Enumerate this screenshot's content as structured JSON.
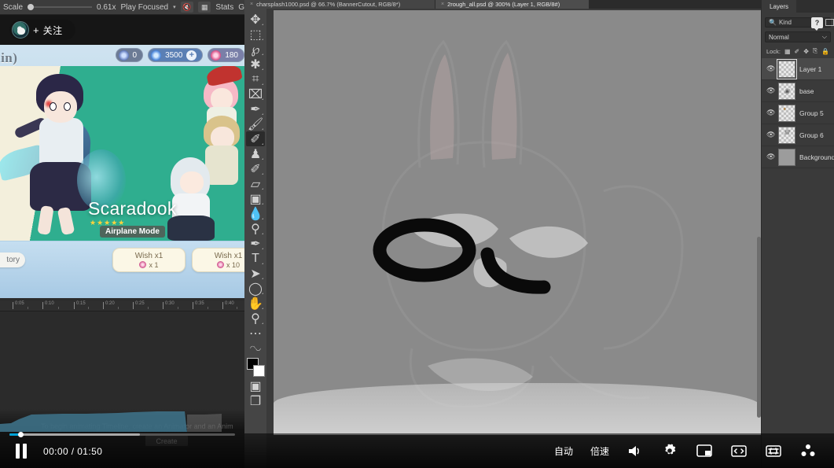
{
  "unity_toolbar": {
    "scale_label": "Scale",
    "scale_value": "0.61x",
    "play_mode": "Play Focused",
    "caret": "▾",
    "audio_icon": "speaker-mute-icon",
    "gizmo_icon": "gizmos-icon",
    "stats_label": "Stats",
    "gizmos_label": "G"
  },
  "game": {
    "follow": {
      "plus": "+",
      "label": "关注"
    },
    "banner_title": "enshin)",
    "currency": [
      {
        "id": "primogem-alt",
        "value": "0",
        "has_plus": false
      },
      {
        "id": "primogem",
        "value": "3500",
        "has_plus": true
      },
      {
        "id": "fate",
        "value": "180",
        "has_plus": false
      }
    ],
    "character_name": "Scaradook",
    "stars": "★★★★★",
    "subtitle": "Airplane Mode",
    "history_button": "tory",
    "wish_buttons": [
      {
        "label": "Wish x1",
        "cost": "x 1"
      },
      {
        "label": "Wish x1",
        "cost": "x 10"
      }
    ]
  },
  "timeline": {
    "ticks": [
      "0:05",
      "0:10",
      "0:15",
      "0:20",
      "0:25",
      "0:30",
      "0:35",
      "0:40"
    ],
    "message": "To begin animating Timeline, create an Animator and an Anim",
    "create_button": "Create"
  },
  "player": {
    "pause_icon": "pause-icon",
    "current_time": "00:00",
    "separator": "/",
    "duration": "01:50",
    "controls": [
      {
        "name": "auto-quality-button",
        "label": "自动",
        "type": "text"
      },
      {
        "name": "playback-speed-button",
        "label": "倍速",
        "type": "text"
      },
      {
        "name": "volume-icon",
        "label": "🔊",
        "type": "icon"
      },
      {
        "name": "settings-gear-icon",
        "label": "⚙",
        "type": "icon"
      },
      {
        "name": "picture-in-picture-icon",
        "label": "◱",
        "type": "icon"
      },
      {
        "name": "wide-screen-icon",
        "label": "⬌",
        "type": "icon"
      },
      {
        "name": "fullscreen-icon",
        "label": "⛶",
        "type": "icon"
      },
      {
        "name": "danmaku-icon",
        "label": "☢",
        "type": "icon"
      }
    ]
  },
  "photoshop": {
    "tabs": [
      {
        "title": "charsplash1000.psd @ 66.7% (BannerCutout, RGB/8*)",
        "close": "×",
        "active": false
      },
      {
        "title": "2rough_all.psd @ 300% (Layer 1, RGB/8#)",
        "close": "×",
        "active": true
      }
    ],
    "tools": [
      {
        "name": "move-tool",
        "glyph": "✥"
      },
      {
        "name": "rectangular-marquee-tool",
        "glyph": "⬚"
      },
      {
        "name": "lasso-tool",
        "glyph": "℘"
      },
      {
        "name": "magic-wand-tool",
        "glyph": "✱"
      },
      {
        "name": "crop-tool",
        "glyph": "⌗"
      },
      {
        "name": "frame-tool",
        "glyph": "⌧"
      },
      {
        "name": "eyedropper-tool",
        "glyph": "✒"
      },
      {
        "name": "spot-healing-brush-tool",
        "glyph": "✚"
      },
      {
        "name": "brush-tool",
        "glyph": "✐",
        "selected": true
      },
      {
        "name": "clone-stamp-tool",
        "glyph": "♟"
      },
      {
        "name": "history-brush-tool",
        "glyph": "✄"
      },
      {
        "name": "eraser-tool",
        "glyph": "◱"
      },
      {
        "name": "gradient-tool",
        "glyph": "▣"
      },
      {
        "name": "blur-tool",
        "glyph": "●"
      },
      {
        "name": "dodge-tool",
        "glyph": "⚲"
      },
      {
        "name": "pen-tool",
        "glyph": "✒"
      },
      {
        "name": "type-tool",
        "glyph": "T"
      },
      {
        "name": "path-selection-tool",
        "glyph": "➤"
      },
      {
        "name": "ellipse-tool",
        "glyph": "◯"
      },
      {
        "name": "hand-tool",
        "glyph": "✋"
      },
      {
        "name": "zoom-tool",
        "glyph": "⚲"
      },
      {
        "name": "edit-toolbar-button",
        "glyph": "⋯"
      },
      {
        "name": "default-colors-icon",
        "glyph": "❐"
      }
    ],
    "screen_mode_tools": [
      {
        "name": "quick-mask-icon",
        "glyph": "▣"
      },
      {
        "name": "screen-mode-icon",
        "glyph": "❐"
      }
    ],
    "layers": {
      "panel_title": "Layers",
      "filter_placeholder": "Kind",
      "filter_icon": "search-icon",
      "help_badge": "?",
      "blend_mode": "Normal",
      "blend_caret": "⌵",
      "lock_label": "Lock:",
      "lock_icons": [
        "transparency-lock-icon",
        "paint-lock-icon",
        "position-lock-icon",
        "artboard-lock-icon",
        "all-lock-icon"
      ],
      "rows": [
        {
          "name": "Layer 1",
          "visible": "👁",
          "selected": true,
          "thumb": "transparent"
        },
        {
          "name": "base",
          "visible": "👁",
          "selected": false,
          "thumb": "transparent-mark"
        },
        {
          "name": "Group 5",
          "visible": "👁",
          "selected": false,
          "thumb": "transparent-mark"
        },
        {
          "name": "Group 6",
          "visible": "👁",
          "selected": false,
          "thumb": "transparent-mark"
        },
        {
          "name": "Background",
          "visible": "👁",
          "selected": false,
          "thumb": "solid"
        }
      ]
    }
  }
}
